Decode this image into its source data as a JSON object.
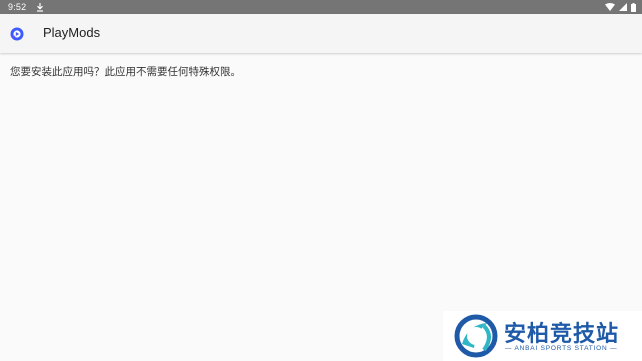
{
  "status_bar": {
    "time": "9:52",
    "icons": [
      "download-icon",
      "wifi-icon",
      "signal-icon",
      "battery-icon"
    ]
  },
  "app_bar": {
    "title": "PlayMods",
    "icon": "playmods-app-icon"
  },
  "installer": {
    "message": "您要安装此应用吗？此应用不需要任何特殊权限。"
  },
  "watermark": {
    "title": "安柏竞技站",
    "subtitle": "ANBAI SPORTS STATION",
    "color": "#1f5aa8"
  },
  "colors": {
    "status_bar_bg": "#757575",
    "app_bar_bg": "#f5f5f5",
    "page_bg": "#fafafa",
    "app_icon_accent": "#3d5afe"
  }
}
